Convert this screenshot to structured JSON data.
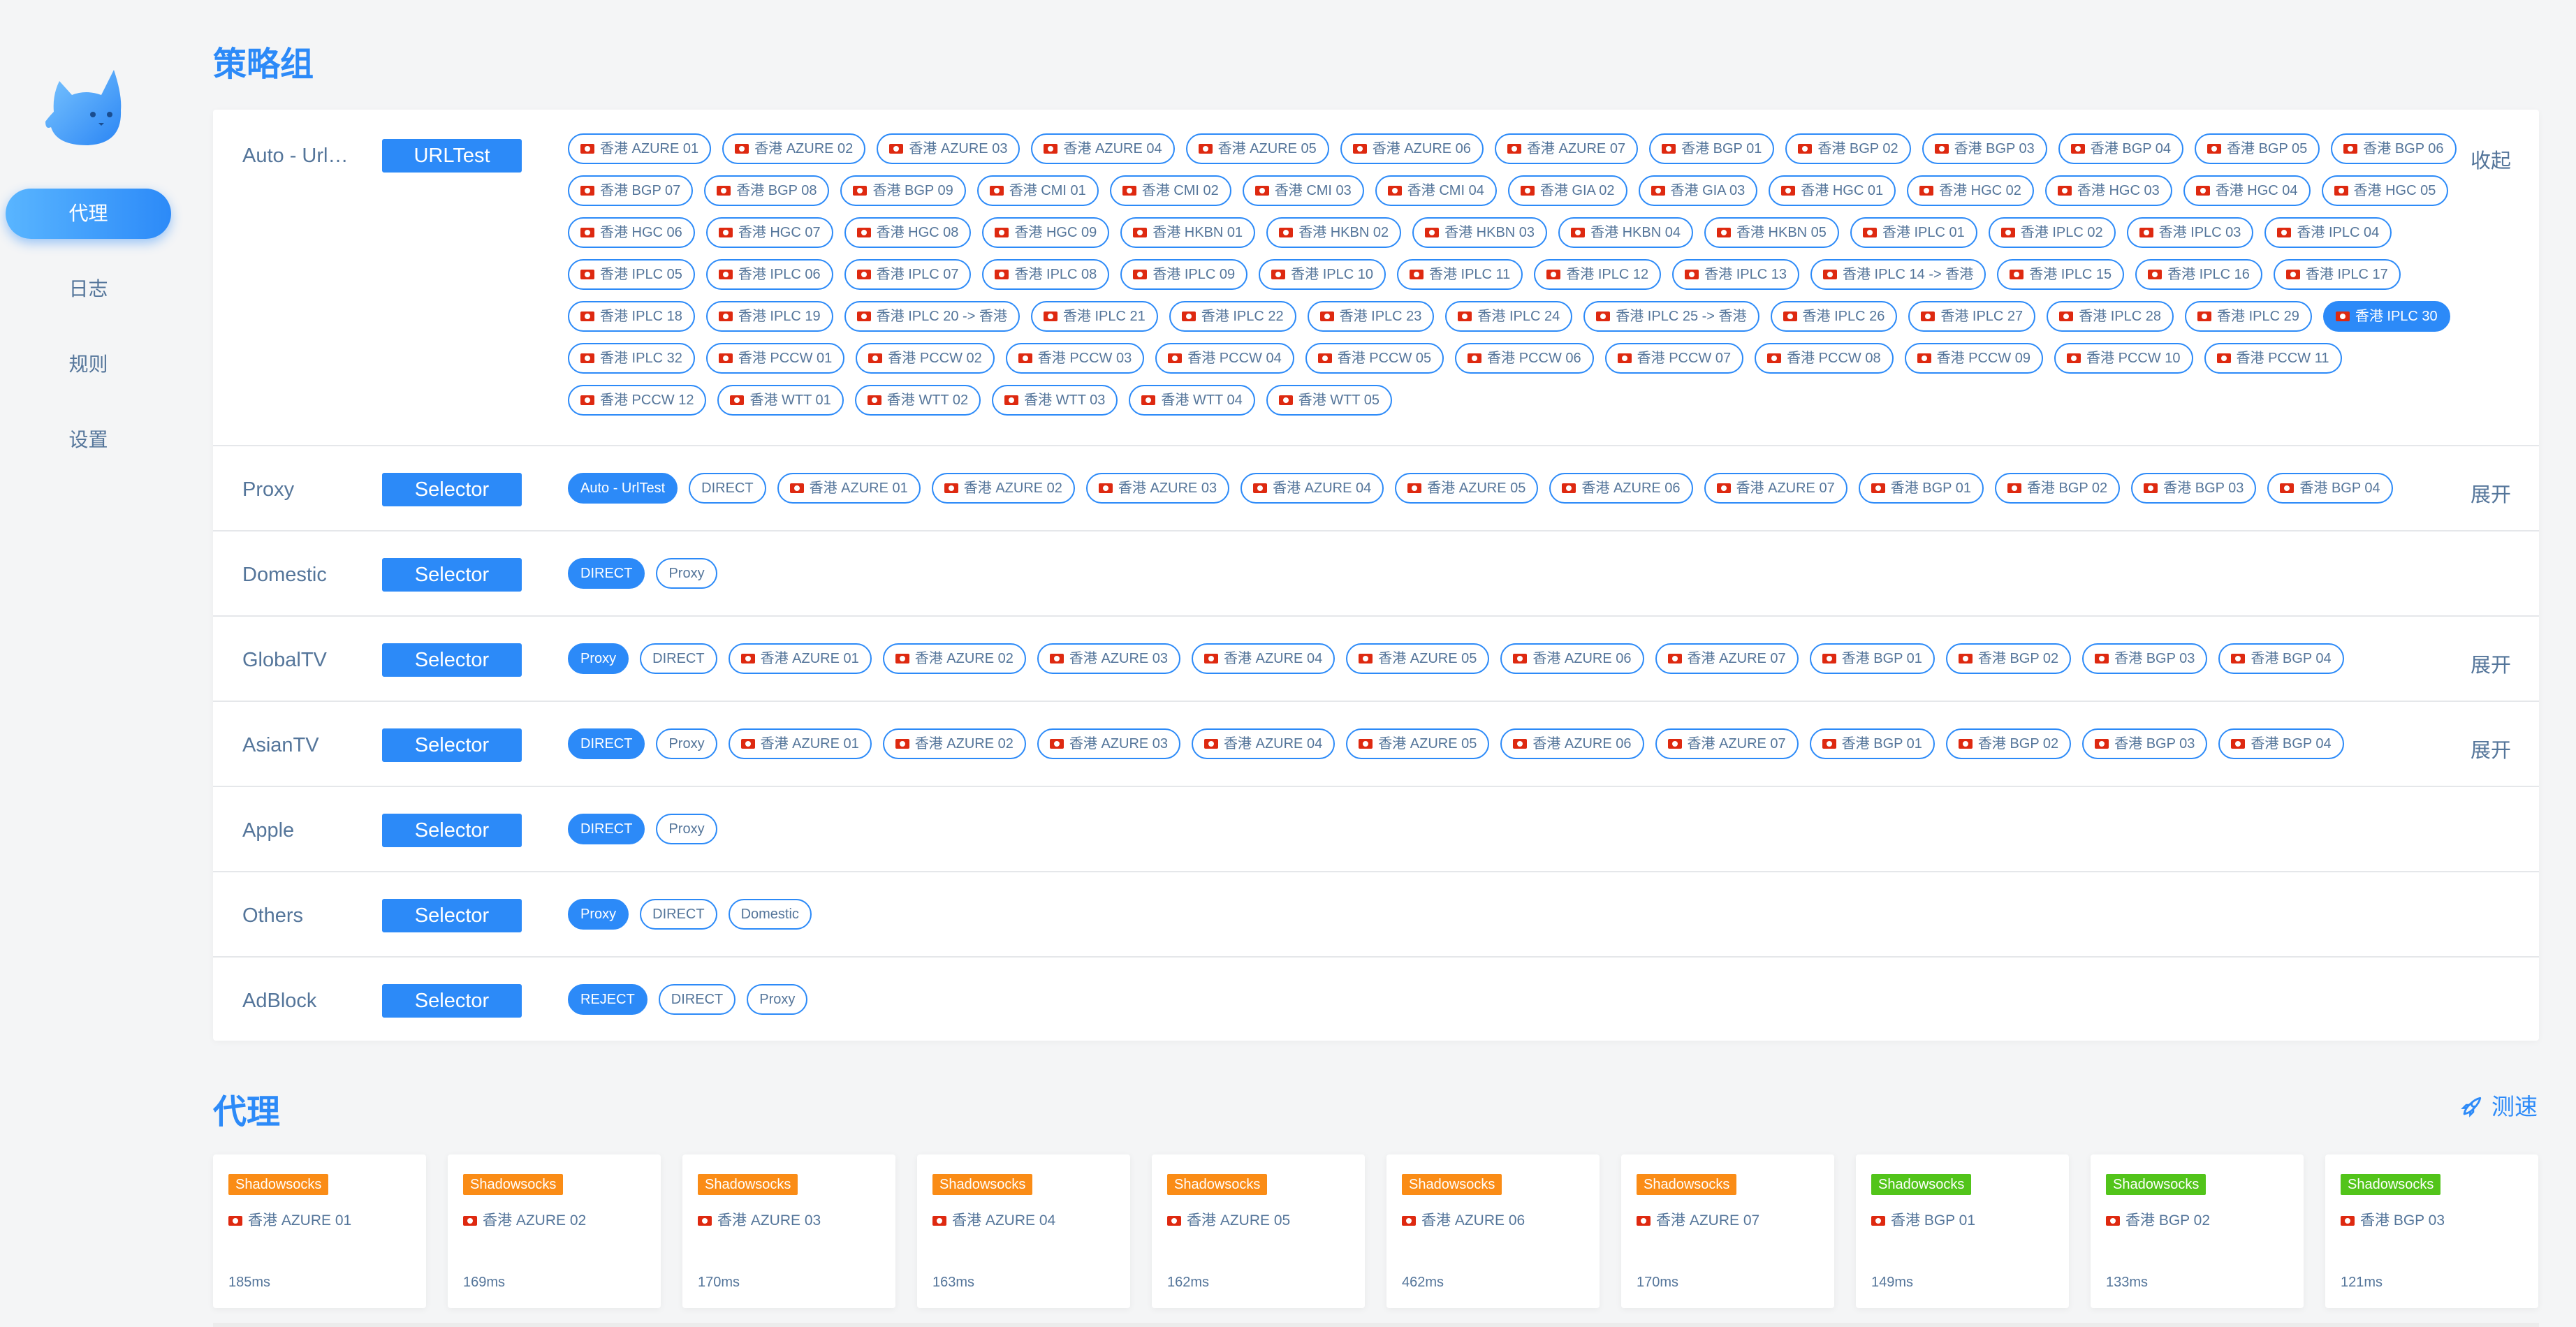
{
  "sidebar": {
    "nav": [
      {
        "label": "代理",
        "active": true
      },
      {
        "label": "日志",
        "active": false
      },
      {
        "label": "规则",
        "active": false
      },
      {
        "label": "设置",
        "active": false
      }
    ]
  },
  "groups_title": "策略组",
  "proxies_title": "代理",
  "speed_test_label": "测速",
  "colors": {
    "accent": "#2c8af8",
    "shadowsocks": "#fa8c16",
    "vmess": "#52c41a",
    "text": "#54759a"
  },
  "groups": [
    {
      "name": "Auto - UrlTest",
      "type": "URLTest",
      "toggle": "收起",
      "tags": [
        "香港 AZURE 01",
        "香港 AZURE 02",
        "香港 AZURE 03",
        "香港 AZURE 04",
        "香港 AZURE 05",
        "香港 AZURE 06",
        "香港 AZURE 07",
        "香港 BGP 01",
        "香港 BGP 02",
        "香港 BGP 03",
        "香港 BGP 04",
        "香港 BGP 05",
        "香港 BGP 06",
        "香港 BGP 07",
        "香港 BGP 08",
        "香港 BGP 09",
        "香港 CMI 01",
        "香港 CMI 02",
        "香港 CMI 03",
        "香港 CMI 04",
        "香港 GIA 02",
        "香港 GIA 03",
        "香港 HGC 01",
        "香港 HGC 02",
        "香港 HGC 03",
        "香港 HGC 04",
        "香港 HGC 05",
        "香港 HGC 06",
        "香港 HGC 07",
        "香港 HGC 08",
        "香港 HGC 09",
        "香港 HKBN 01",
        "香港 HKBN 02",
        "香港 HKBN 03",
        "香港 HKBN 04",
        "香港 HKBN 05",
        "香港 IPLC 01",
        "香港 IPLC 02",
        "香港 IPLC 03",
        "香港 IPLC 04",
        "香港 IPLC 05",
        "香港 IPLC 06",
        "香港 IPLC 07",
        "香港 IPLC 08",
        "香港 IPLC 09",
        "香港 IPLC 10",
        "香港 IPLC 11",
        "香港 IPLC 12",
        "香港 IPLC 13",
        "香港 IPLC 14 -> 香港",
        "香港 IPLC 15",
        "香港 IPLC 16",
        "香港 IPLC 17",
        "香港 IPLC 18",
        "香港 IPLC 19",
        "香港 IPLC 20 -> 香港",
        "香港 IPLC 21",
        "香港 IPLC 22",
        "香港 IPLC 23",
        "香港 IPLC 24",
        "香港 IPLC 25 -> 香港",
        "香港 IPLC 26",
        "香港 IPLC 27",
        "香港 IPLC 28",
        "香港 IPLC 29",
        "香港 IPLC 30",
        "香港 IPLC 32",
        "香港 PCCW 01",
        "香港 PCCW 02",
        "香港 PCCW 03",
        "香港 PCCW 04",
        "香港 PCCW 05",
        "香港 PCCW 06",
        "香港 PCCW 07",
        "香港 PCCW 08",
        "香港 PCCW 09",
        "香港 PCCW 10",
        "香港 PCCW 11",
        "香港 PCCW 12",
        "香港 WTT 01",
        "香港 WTT 02",
        "香港 WTT 03",
        "香港 WTT 04",
        "香港 WTT 05"
      ],
      "selected": "香港 IPLC 30"
    },
    {
      "name": "Proxy",
      "type": "Selector",
      "toggle": "展开",
      "tags": [
        "Auto - UrlTest",
        "DIRECT",
        "香港 AZURE 01",
        "香港 AZURE 02",
        "香港 AZURE 03",
        "香港 AZURE 04",
        "香港 AZURE 05",
        "香港 AZURE 06",
        "香港 AZURE 07",
        "香港 BGP 01",
        "香港 BGP 02",
        "香港 BGP 03",
        "香港 BGP 04"
      ],
      "selected": "Auto - UrlTest"
    },
    {
      "name": "Domestic",
      "type": "Selector",
      "toggle": "",
      "tags": [
        "DIRECT",
        "Proxy"
      ],
      "selected": "DIRECT"
    },
    {
      "name": "GlobalTV",
      "type": "Selector",
      "toggle": "展开",
      "tags": [
        "Proxy",
        "DIRECT",
        "香港 AZURE 01",
        "香港 AZURE 02",
        "香港 AZURE 03",
        "香港 AZURE 04",
        "香港 AZURE 05",
        "香港 AZURE 06",
        "香港 AZURE 07",
        "香港 BGP 01",
        "香港 BGP 02",
        "香港 BGP 03",
        "香港 BGP 04"
      ],
      "selected": "Proxy"
    },
    {
      "name": "AsianTV",
      "type": "Selector",
      "toggle": "展开",
      "tags": [
        "DIRECT",
        "Proxy",
        "香港 AZURE 01",
        "香港 AZURE 02",
        "香港 AZURE 03",
        "香港 AZURE 04",
        "香港 AZURE 05",
        "香港 AZURE 06",
        "香港 AZURE 07",
        "香港 BGP 01",
        "香港 BGP 02",
        "香港 BGP 03",
        "香港 BGP 04"
      ],
      "selected": "DIRECT"
    },
    {
      "name": "Apple",
      "type": "Selector",
      "toggle": "",
      "tags": [
        "DIRECT",
        "Proxy"
      ],
      "selected": "DIRECT"
    },
    {
      "name": "Others",
      "type": "Selector",
      "toggle": "",
      "tags": [
        "Proxy",
        "DIRECT",
        "Domestic"
      ],
      "selected": "Proxy"
    },
    {
      "name": "AdBlock",
      "type": "Selector",
      "toggle": "",
      "tags": [
        "REJECT",
        "DIRECT",
        "Proxy"
      ],
      "selected": "REJECT"
    }
  ],
  "proxies": [
    {
      "type": "Shadowsocks",
      "name": "香港 AZURE 01",
      "latency": "185ms"
    },
    {
      "type": "Shadowsocks",
      "name": "香港 AZURE 02",
      "latency": "169ms"
    },
    {
      "type": "Shadowsocks",
      "name": "香港 AZURE 03",
      "latency": "170ms"
    },
    {
      "type": "Shadowsocks",
      "name": "香港 AZURE 04",
      "latency": "163ms"
    },
    {
      "type": "Shadowsocks",
      "name": "香港 AZURE 05",
      "latency": "162ms"
    },
    {
      "type": "Shadowsocks",
      "name": "香港 AZURE 06",
      "latency": "462ms"
    },
    {
      "type": "Shadowsocks",
      "name": "香港 AZURE 07",
      "latency": "170ms"
    },
    {
      "type": "Shadowsocks",
      "name": "香港 BGP 01",
      "latency": "149ms"
    },
    {
      "type": "Shadowsocks",
      "name": "香港 BGP 02",
      "latency": "133ms"
    },
    {
      "type": "Shadowsocks",
      "name": "香港 BGP 03",
      "latency": "121ms"
    }
  ]
}
